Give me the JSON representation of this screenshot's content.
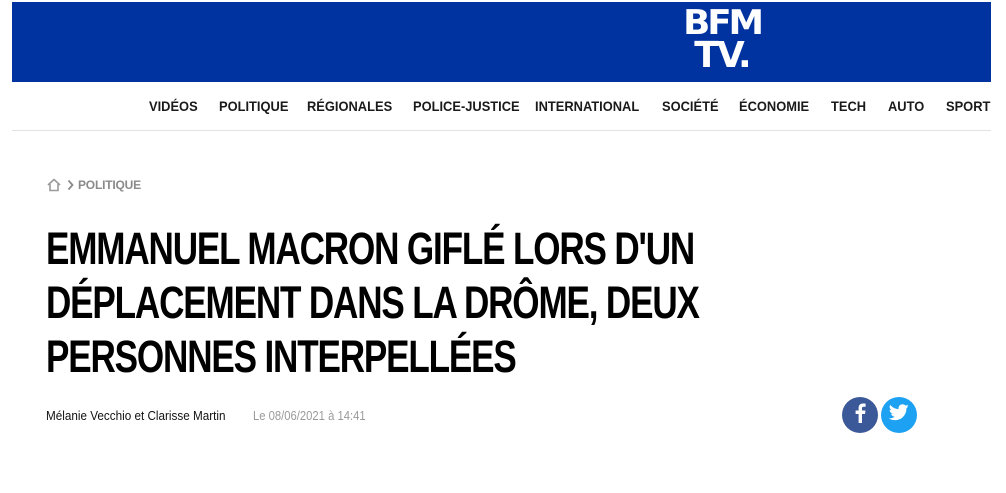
{
  "site": {
    "logo_line1": "BFM",
    "logo_line2": "TV.",
    "brand_color": "#0033a0"
  },
  "nav": {
    "items": [
      "VIDÉOS",
      "POLITIQUE",
      "RÉGIONALES",
      "POLICE-JUSTICE",
      "INTERNATIONAL",
      "SOCIÉTÉ",
      "ÉCONOMIE",
      "TECH",
      "AUTO",
      "SPORT"
    ]
  },
  "breadcrumb": {
    "home_icon": "home-icon",
    "separator_icon": "chevron-right-icon",
    "section": "POLITIQUE"
  },
  "article": {
    "headline": "EMMANUEL MACRON GIFLÉ LORS D'UN DÉPLACEMENT DANS LA DRÔME, DEUX PERSONNES INTERPELLÉES",
    "authors": "Mélanie Vecchio et Clarisse Martin",
    "date": "Le 08/06/2021 à 14:41"
  },
  "share": {
    "facebook_icon": "facebook-icon",
    "twitter_icon": "twitter-icon",
    "facebook_color": "#3b5998",
    "twitter_color": "#1da1f2"
  }
}
